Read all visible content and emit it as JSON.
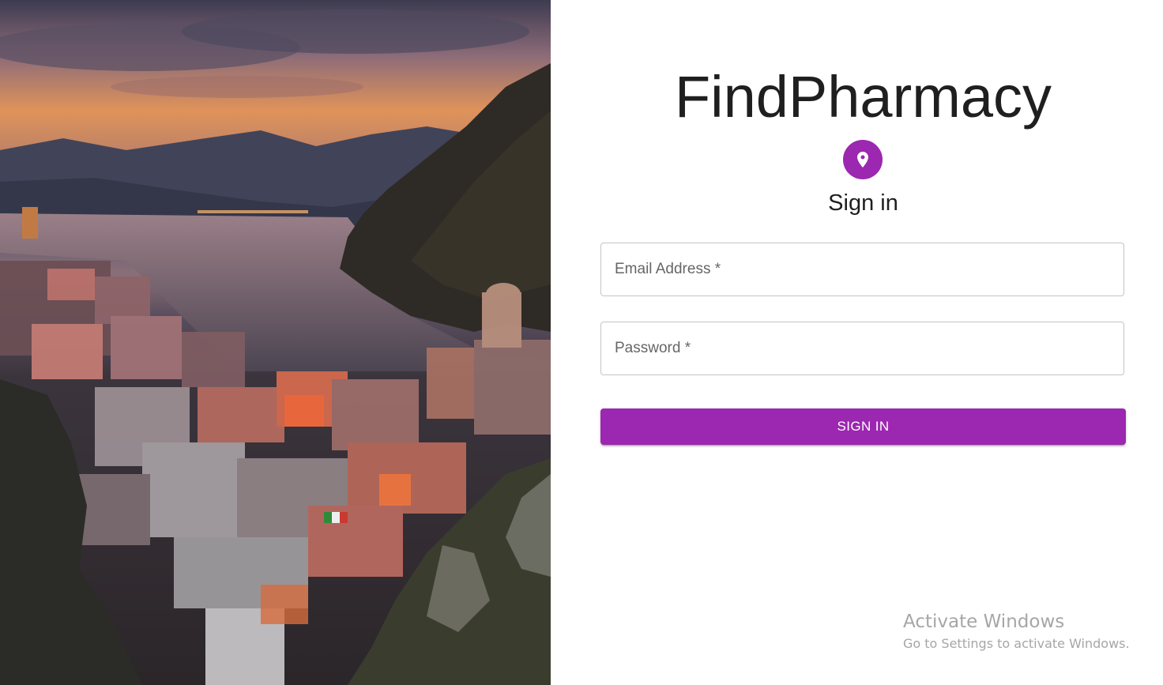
{
  "app": {
    "title": "FindPharmacy"
  },
  "login": {
    "heading": "Sign in",
    "avatar_icon": "location-pin-icon",
    "email": {
      "label": "Email Address *",
      "value": ""
    },
    "password": {
      "label": "Password *",
      "value": ""
    },
    "submit_label": "SIGN IN"
  },
  "watermark": {
    "title": "Activate Windows",
    "subtitle": "Go to Settings to activate Windows."
  },
  "colors": {
    "primary": "#9c27b0",
    "text": "#1f1f1f",
    "border": "#c4c4c4"
  }
}
